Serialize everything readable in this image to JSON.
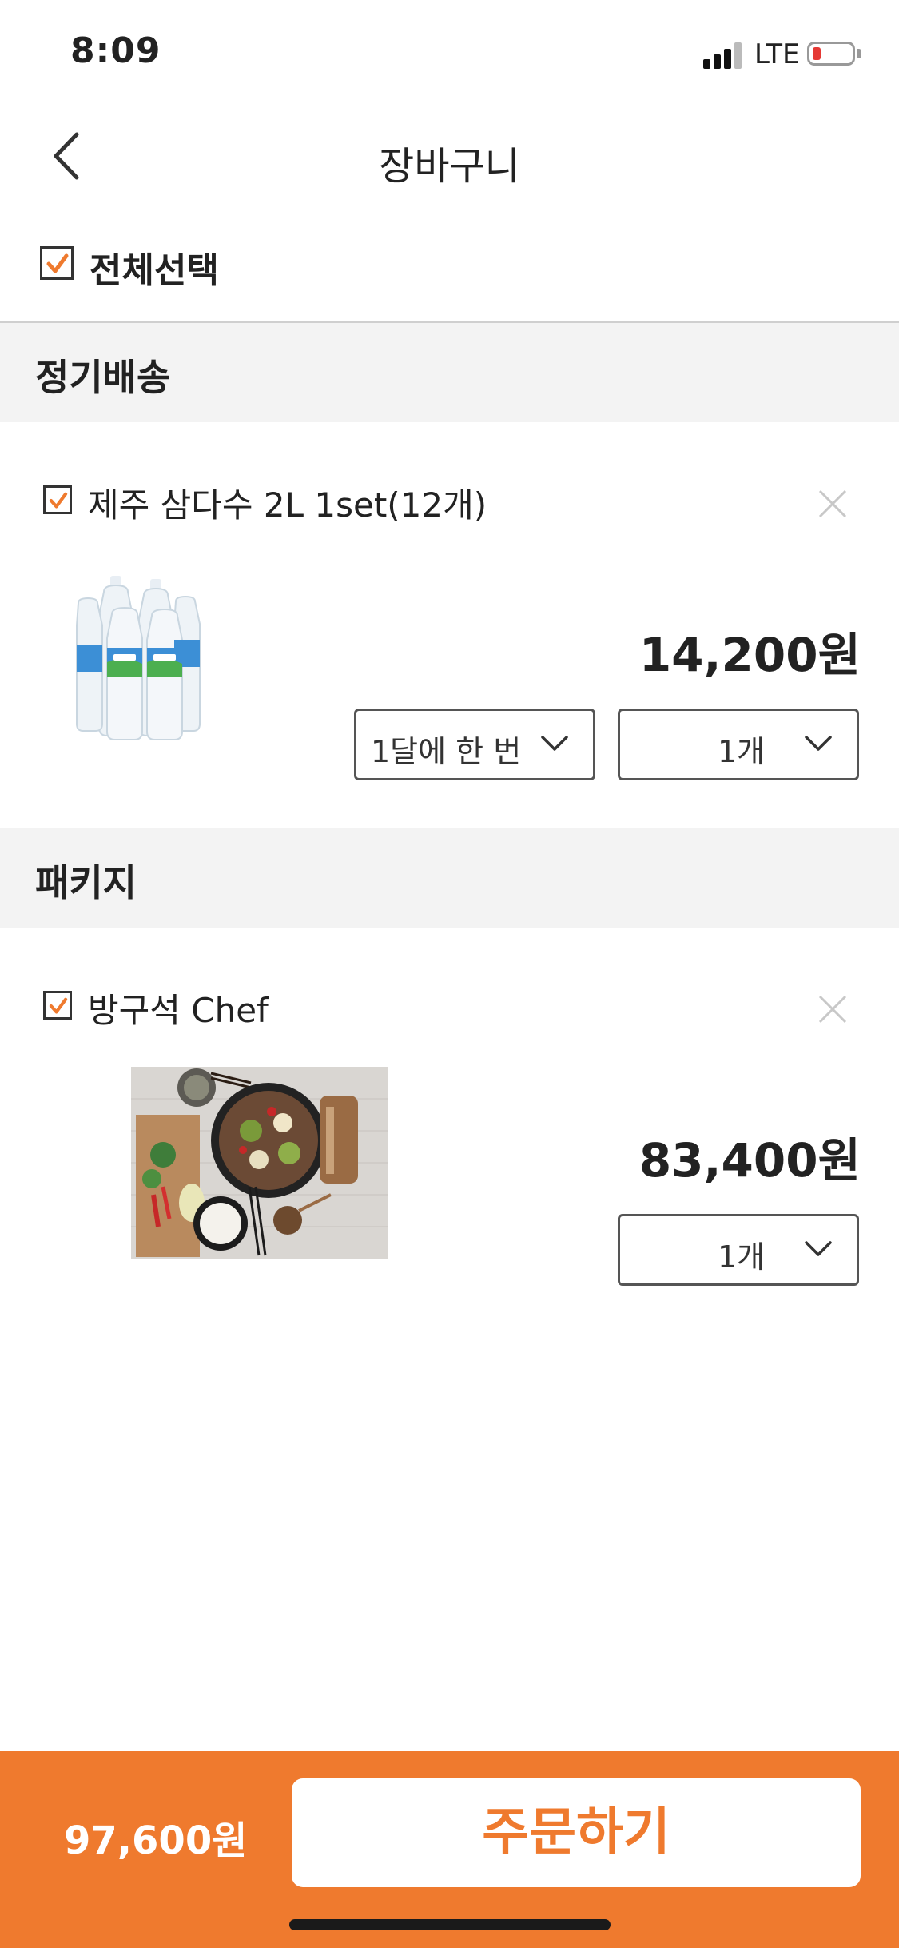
{
  "status_bar": {
    "time": "8:09",
    "network": "LTE"
  },
  "header": {
    "title": "장바구니"
  },
  "select_all": {
    "label": "전체선택",
    "checked": true
  },
  "sections": [
    {
      "label": "정기배송",
      "item": {
        "name": "제주 삼다수 2L 1set(12개)",
        "checked": true,
        "price": "14,200원",
        "frequency": "1달에 한 번",
        "quantity": "1개",
        "image": "water-bottles-image"
      }
    },
    {
      "label": "패키지",
      "item": {
        "name": "방구석 Chef",
        "checked": true,
        "price": "83,400원",
        "quantity": "1개",
        "image": "hotpot-meal-image"
      }
    }
  ],
  "footer": {
    "total": "97,600원",
    "order_label": "주문하기"
  },
  "colors": {
    "accent": "#ef7a2e",
    "battery_low": "#e53935"
  }
}
